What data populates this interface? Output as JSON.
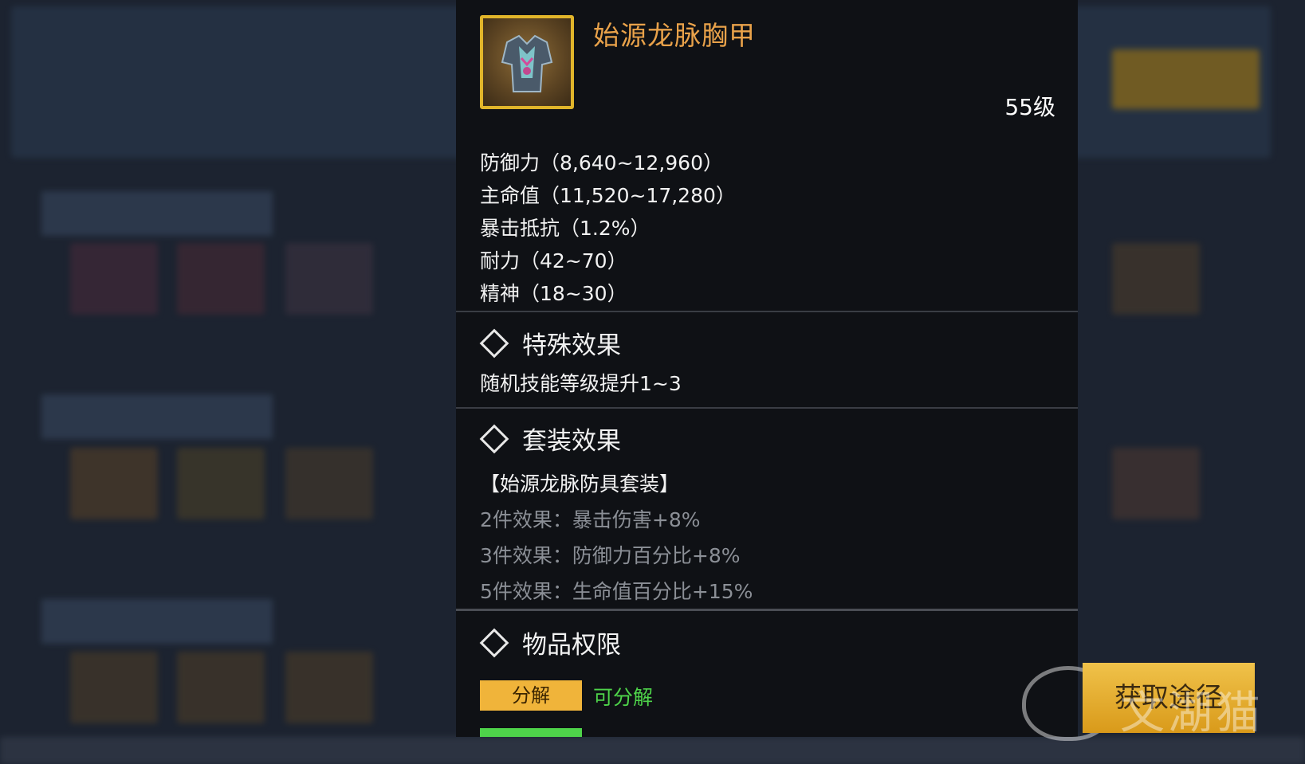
{
  "item": {
    "name": "始源龙脉胸甲",
    "level": "55级",
    "stats": [
      "防御力（8,640~12,960）",
      "主命值（11,520~17,280）",
      "暴击抵抗（1.2%）",
      "耐力（42~70）",
      "精神（18~30）"
    ]
  },
  "special": {
    "title": "特殊效果",
    "text": "随机技能等级提升1~3"
  },
  "set": {
    "title": "套装效果",
    "name": "【始源龙脉防具套装】",
    "effects": [
      "2件效果：暴击伤害+8%",
      "3件效果：防御力百分比+8%",
      "5件效果：生命值百分比+15%"
    ]
  },
  "permission": {
    "title": "物品权限",
    "decompose_tag": "分解",
    "decompose_text": "可分解"
  },
  "obtain_button": "获取途径",
  "watermark": "文湖猫",
  "colors": {
    "item_name": "#e9a24a",
    "icon_border": "#e1b52a",
    "decompose_tag": "#f0b43a",
    "ok_green": "#4ed34a",
    "button": "#f0c24a"
  }
}
